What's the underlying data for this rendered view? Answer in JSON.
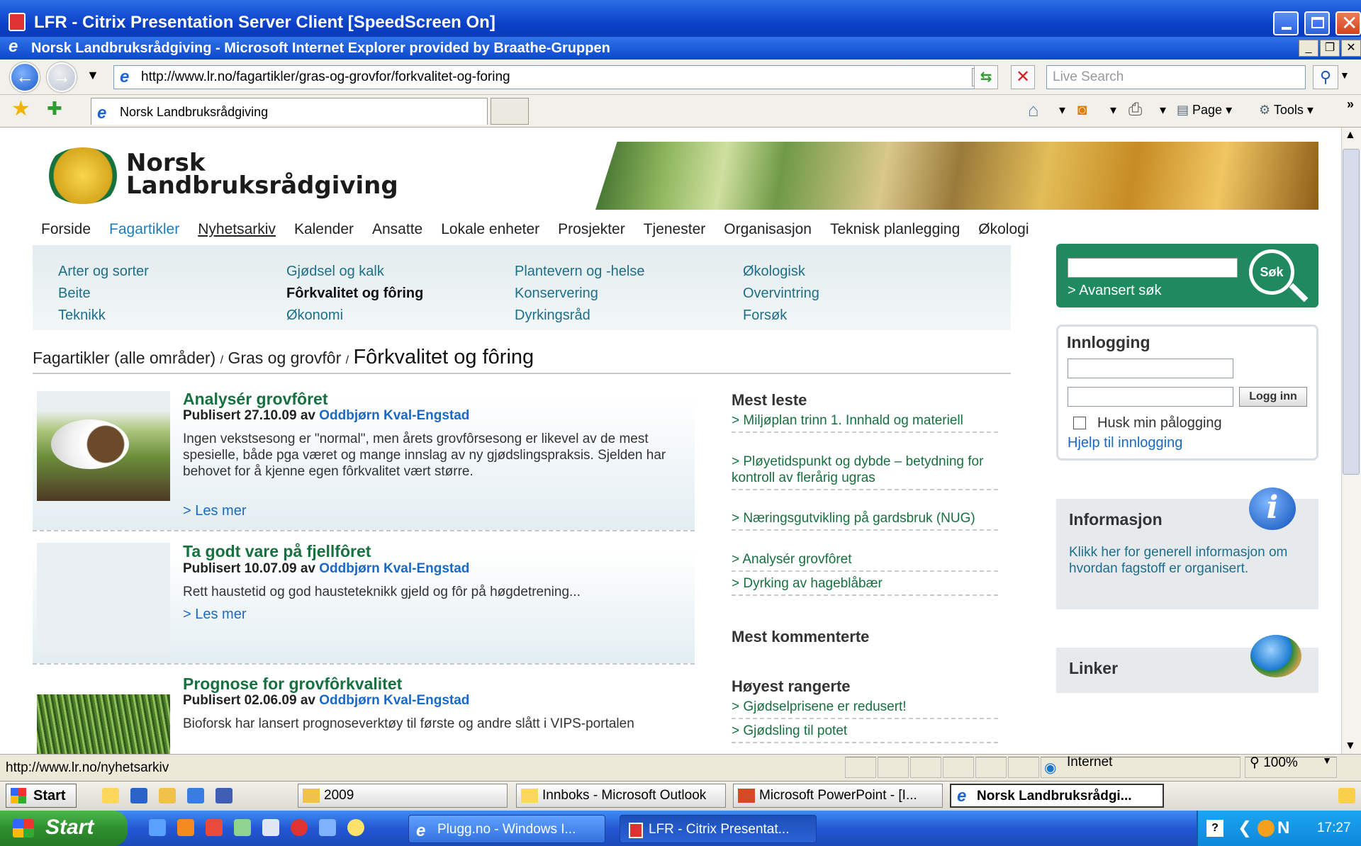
{
  "citrix_window": {
    "title": "LFR - Citrix Presentation Server Client [SpeedScreen On]"
  },
  "ie_window": {
    "title": "Norsk Landbruksrådgiving - Microsoft Internet Explorer provided by Braathe-Gruppen"
  },
  "address_bar": {
    "url": "http://www.lr.no/fagartikler/gras-og-grovfor/forkvalitet-og-foring"
  },
  "search": {
    "placeholder": "Live Search"
  },
  "tab": {
    "title": "Norsk Landbruksrådgiving"
  },
  "command_bar": {
    "page_label": "Page",
    "tools_label": "Tools"
  },
  "site": {
    "brand_line1": "Norsk",
    "brand_line2": "Landbruksrådgiving",
    "main_nav": [
      "Forside",
      "Fagartikler",
      "Nyhetsarkiv",
      "Kalender",
      "Ansatte",
      "Lokale enheter",
      "Prosjekter",
      "Tjenester",
      "Organisasjon",
      "Teknisk planlegging",
      "Økologi"
    ],
    "sub_nav": {
      "col1": [
        "Arter og sorter",
        "Beite",
        "Teknikk"
      ],
      "col2": [
        "Gjødsel og kalk",
        "Fôrkvalitet og fôring",
        "Økonomi"
      ],
      "col3": [
        "Plantevern og -helse",
        "Konservering",
        "Dyrkingsråd"
      ],
      "col4": [
        "Økologisk",
        "Overvintring",
        "Forsøk"
      ]
    },
    "breadcrumb": {
      "part1": "Fagartikler (alle områder)",
      "sep": "/",
      "part2": "Gras og grovfôr",
      "current": "Fôrkvalitet og fôring"
    },
    "articles": [
      {
        "title": "Analysér grovfôret",
        "published": "Publisert 27.10.09 av",
        "author": "Oddbjørn Kval-Engstad",
        "body": "Ingen vekstsesong er \"normal\", men årets grovfôrsesong er likevel av de mest spesielle, både pga været og mange innslag av ny gjødslingspraksis. Sjelden har behovet for å kjenne egen fôrkvalitet vært større.",
        "more": "> Les mer"
      },
      {
        "title": "Ta godt vare på fjellfôret",
        "published": "Publisert 10.07.09 av",
        "author": "Oddbjørn Kval-Engstad",
        "body": "Rett haustetid og god hausteteknikk gjeld og fôr på høgdetrening...",
        "more": "> Les mer"
      },
      {
        "title": "Prognose for grovfôrkvalitet",
        "published": "Publisert 02.06.09 av",
        "author": "Oddbjørn Kval-Engstad",
        "body": "Bioforsk har lansert prognoseverktøy til første og andre slått i VIPS-portalen"
      }
    ],
    "most_read": {
      "heading": "Mest leste",
      "items": [
        "> Miljøplan trinn 1. Innhald og materiell",
        "> Pløyetidspunkt og dybde – betydning for kontroll av flerårig ugras",
        "> Næringsgutvikling på gardsbruk (NUG)",
        "> Analysér grovfôret",
        "> Dyrking av hageblåbær"
      ]
    },
    "most_commented": {
      "heading": "Mest kommenterte"
    },
    "top_rated": {
      "heading": "Høyest rangerte",
      "items": [
        "> Gjødselprisene er redusert!",
        "> Gjødsling til potet"
      ]
    },
    "search_panel": {
      "button": "Søk",
      "advanced": "> Avansert søk"
    },
    "login": {
      "title": "Innlogging",
      "button": "Logg inn",
      "remember": "Husk min pålogging",
      "help": "Hjelp til innlogging"
    },
    "info": {
      "title": "Informasjon",
      "text": "Klikk her for generell informasjon om hvordan fagstoff er organisert.",
      "icon_letter": "i"
    },
    "links": {
      "title": "Linker"
    }
  },
  "status_bar": {
    "url": "http://www.lr.no/nyhetsarkiv",
    "zone": "Internet",
    "zoom": "100%"
  },
  "inner_taskbar": {
    "start": "Start",
    "folder": "2009",
    "items": [
      "Innboks - Microsoft Outlook",
      "Microsoft PowerPoint - [I...",
      "Norsk Landbruksrådgi..."
    ]
  },
  "taskbar": {
    "start": "Start",
    "items": [
      "Plugg.no - Windows I...",
      "LFR - Citrix Presentat..."
    ],
    "clock": "17:27"
  }
}
